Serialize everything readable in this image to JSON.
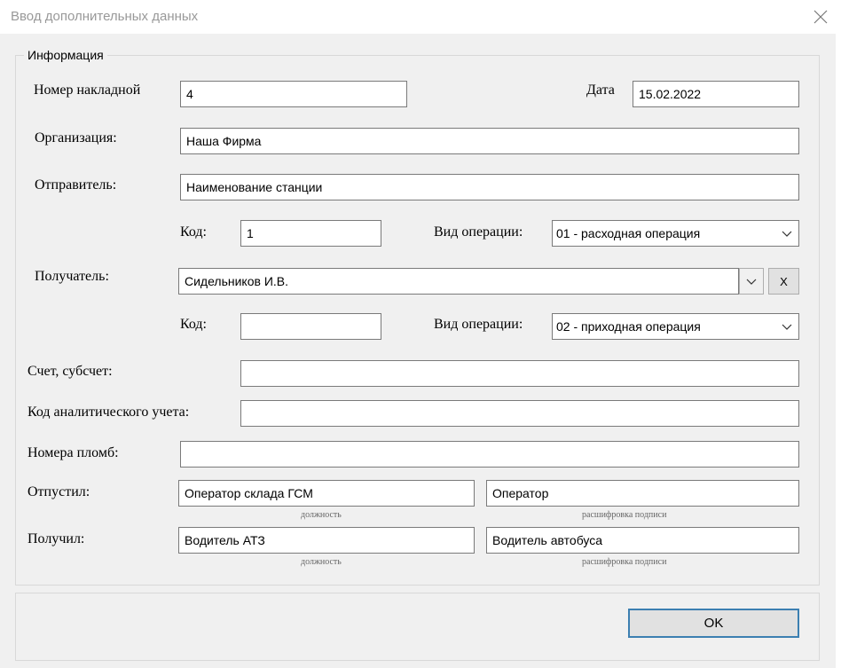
{
  "window": {
    "title": "Ввод дополнительных данных"
  },
  "info": {
    "legend": "Информация",
    "invoice_number": {
      "label": "Номер накладной",
      "value": "4"
    },
    "date": {
      "label": "Дата",
      "value": "15.02.2022"
    },
    "organization": {
      "label": "Организация:",
      "value": "Наша Фирма"
    },
    "sender": {
      "label": "Отправитель:",
      "value": "Наименование станции",
      "code_label": "Код:",
      "code_value": "1",
      "operation_label": "Вид операции:",
      "operation_value": "01 - расходная операция"
    },
    "recipient": {
      "label": "Получатель:",
      "value": "Сидельников И.В.",
      "clear_label": "X",
      "code_label": "Код:",
      "code_value": "",
      "operation_label": "Вид операции:",
      "operation_value": "02 - приходная операция"
    },
    "account": {
      "label": "Счет, субсчет:",
      "value": ""
    },
    "analytic_code": {
      "label": "Код аналитического учета:",
      "value": ""
    },
    "seals": {
      "label": "Номера пломб:",
      "value": ""
    },
    "released": {
      "label": "Отпустил:",
      "position": "Оператор склада ГСМ",
      "signature": "Оператор",
      "position_caption": "должность",
      "signature_caption": "расшифровка подписи"
    },
    "received": {
      "label": "Получил:",
      "position": "Водитель АТЗ",
      "signature": "Водитель автобуса",
      "position_caption": "должность",
      "signature_caption": "расшифровка подписи"
    }
  },
  "footer": {
    "ok_label": "OK"
  }
}
